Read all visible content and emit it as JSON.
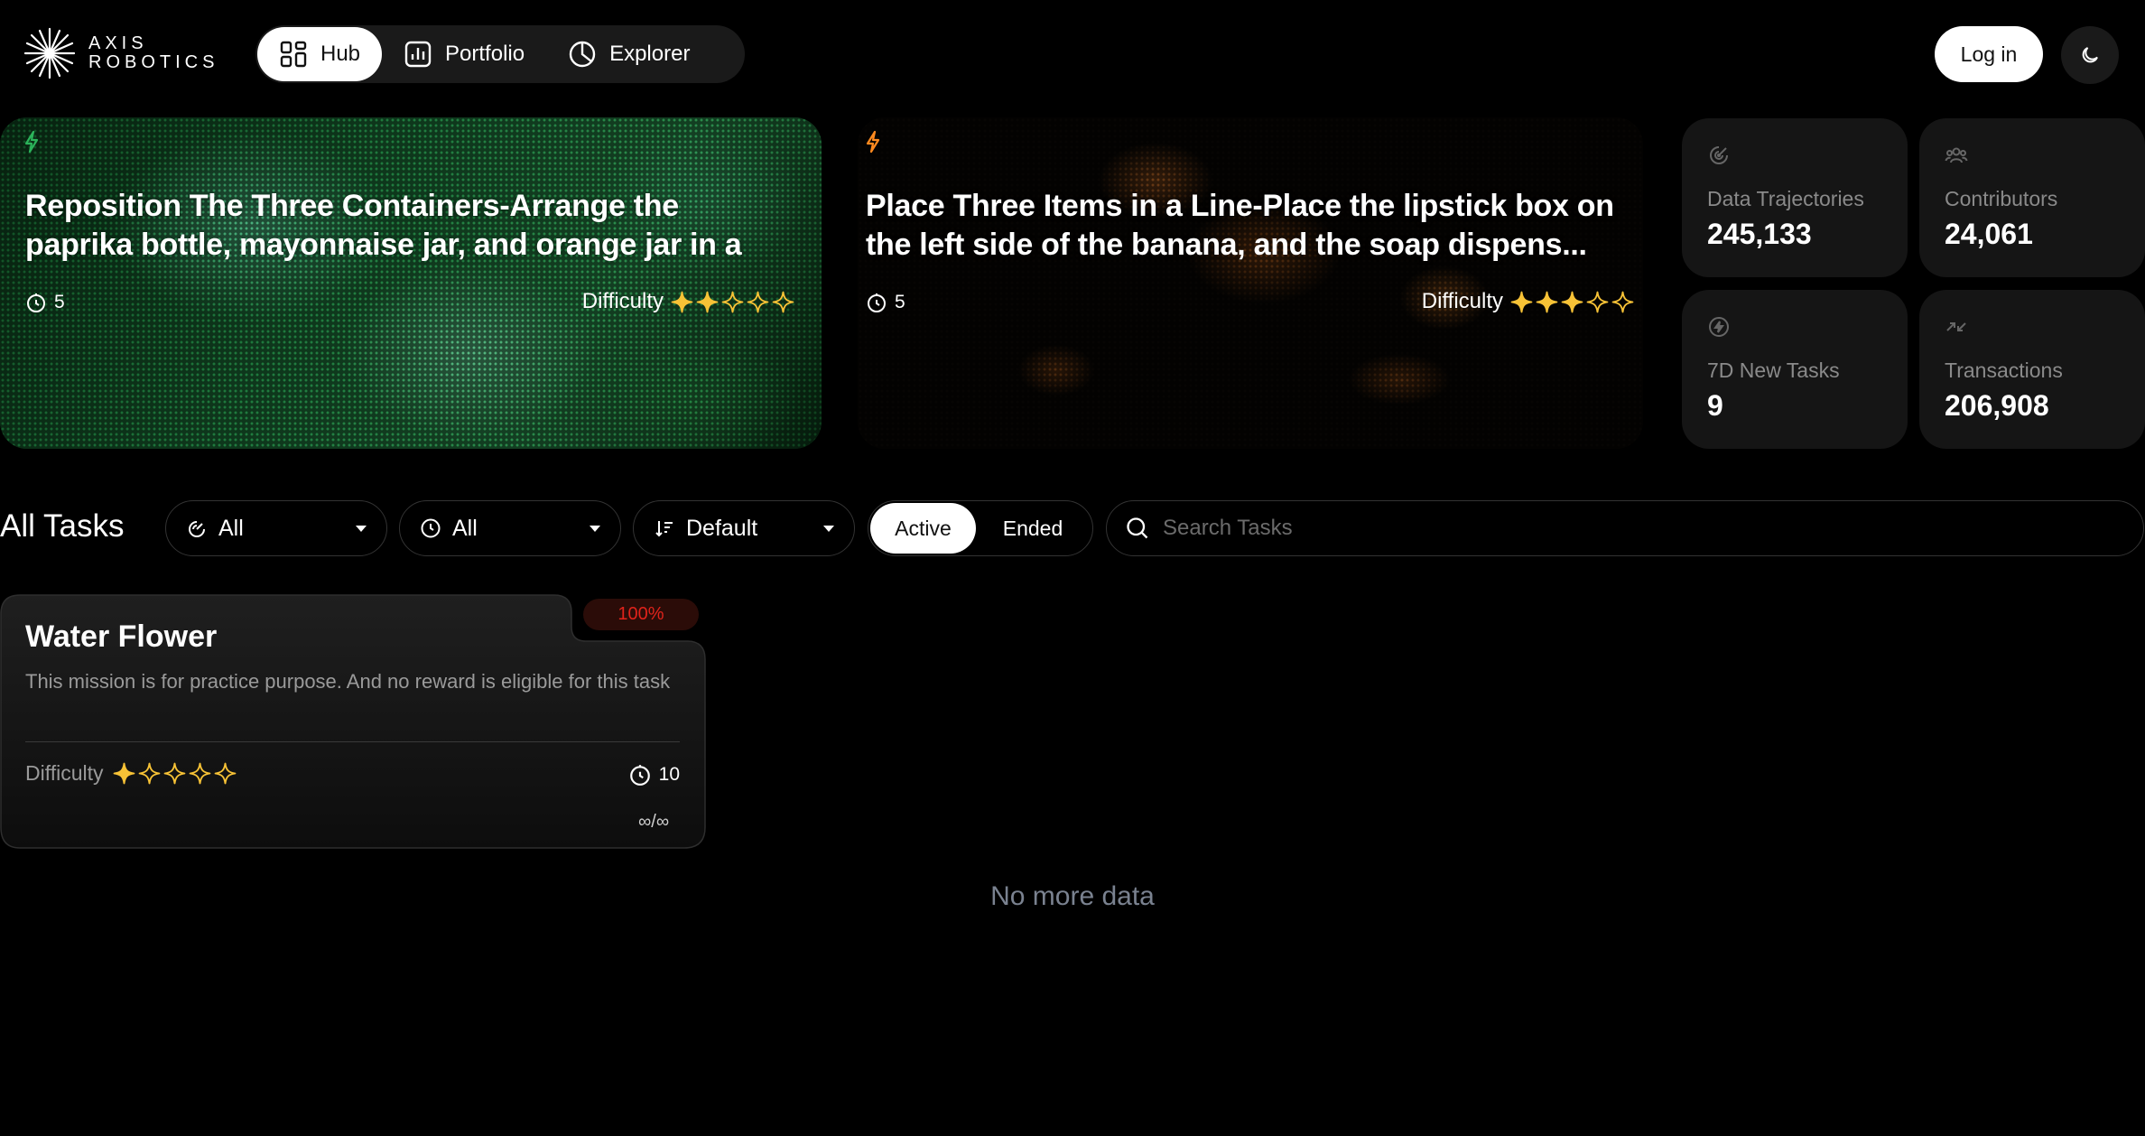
{
  "brand": {
    "line1": "AXIS",
    "line2": "ROBOTICS"
  },
  "nav": [
    {
      "label": "Hub",
      "icon": "grid-icon",
      "active": true
    },
    {
      "label": "Portfolio",
      "icon": "bar-chart-icon",
      "active": false
    },
    {
      "label": "Explorer",
      "icon": "pie-chart-icon",
      "active": false
    }
  ],
  "header": {
    "login_label": "Log in",
    "theme_icon": "moon-icon"
  },
  "featured": [
    {
      "title": "Reposition The Three Containers-Arrange the paprika bottle, mayonnaise jar, and orange jar in a strai...",
      "count": "5",
      "difficulty_label": "Difficulty",
      "difficulty": 2,
      "accent": "#2bb35a"
    },
    {
      "title": "Place Three Items in a Line-Place the lipstick box on the left side of the banana, and the soap dispens...",
      "count": "5",
      "difficulty_label": "Difficulty",
      "difficulty": 3,
      "accent": "#ff8a1f"
    }
  ],
  "stats": [
    {
      "label": "Data Trajectories",
      "value": "245,133",
      "icon": "target-icon"
    },
    {
      "label": "Contributors",
      "value": "24,061",
      "icon": "users-icon"
    },
    {
      "label": "7D New Tasks",
      "value": "9",
      "icon": "bolt-circle-icon"
    },
    {
      "label": "Transactions",
      "value": "206,908",
      "icon": "arrows-in-icon"
    }
  ],
  "filters": {
    "section_title": "All Tasks",
    "category": "All",
    "time": "All",
    "sort": "Default",
    "status_options": [
      "Active",
      "Ended"
    ],
    "status_selected": "Active",
    "search_placeholder": "Search Tasks"
  },
  "tasks": [
    {
      "title": "Water Flower",
      "badge": "100%",
      "description": "This mission is for practice purpose. And no reward is eligible for this task",
      "difficulty_label": "Difficulty",
      "difficulty": 1,
      "count": "10",
      "ratio": "∞/∞"
    }
  ],
  "footer_note": "No more data",
  "colors": {
    "star": "#f7c236",
    "badge_text": "#e0231b",
    "muted": "#8a8a8a"
  }
}
